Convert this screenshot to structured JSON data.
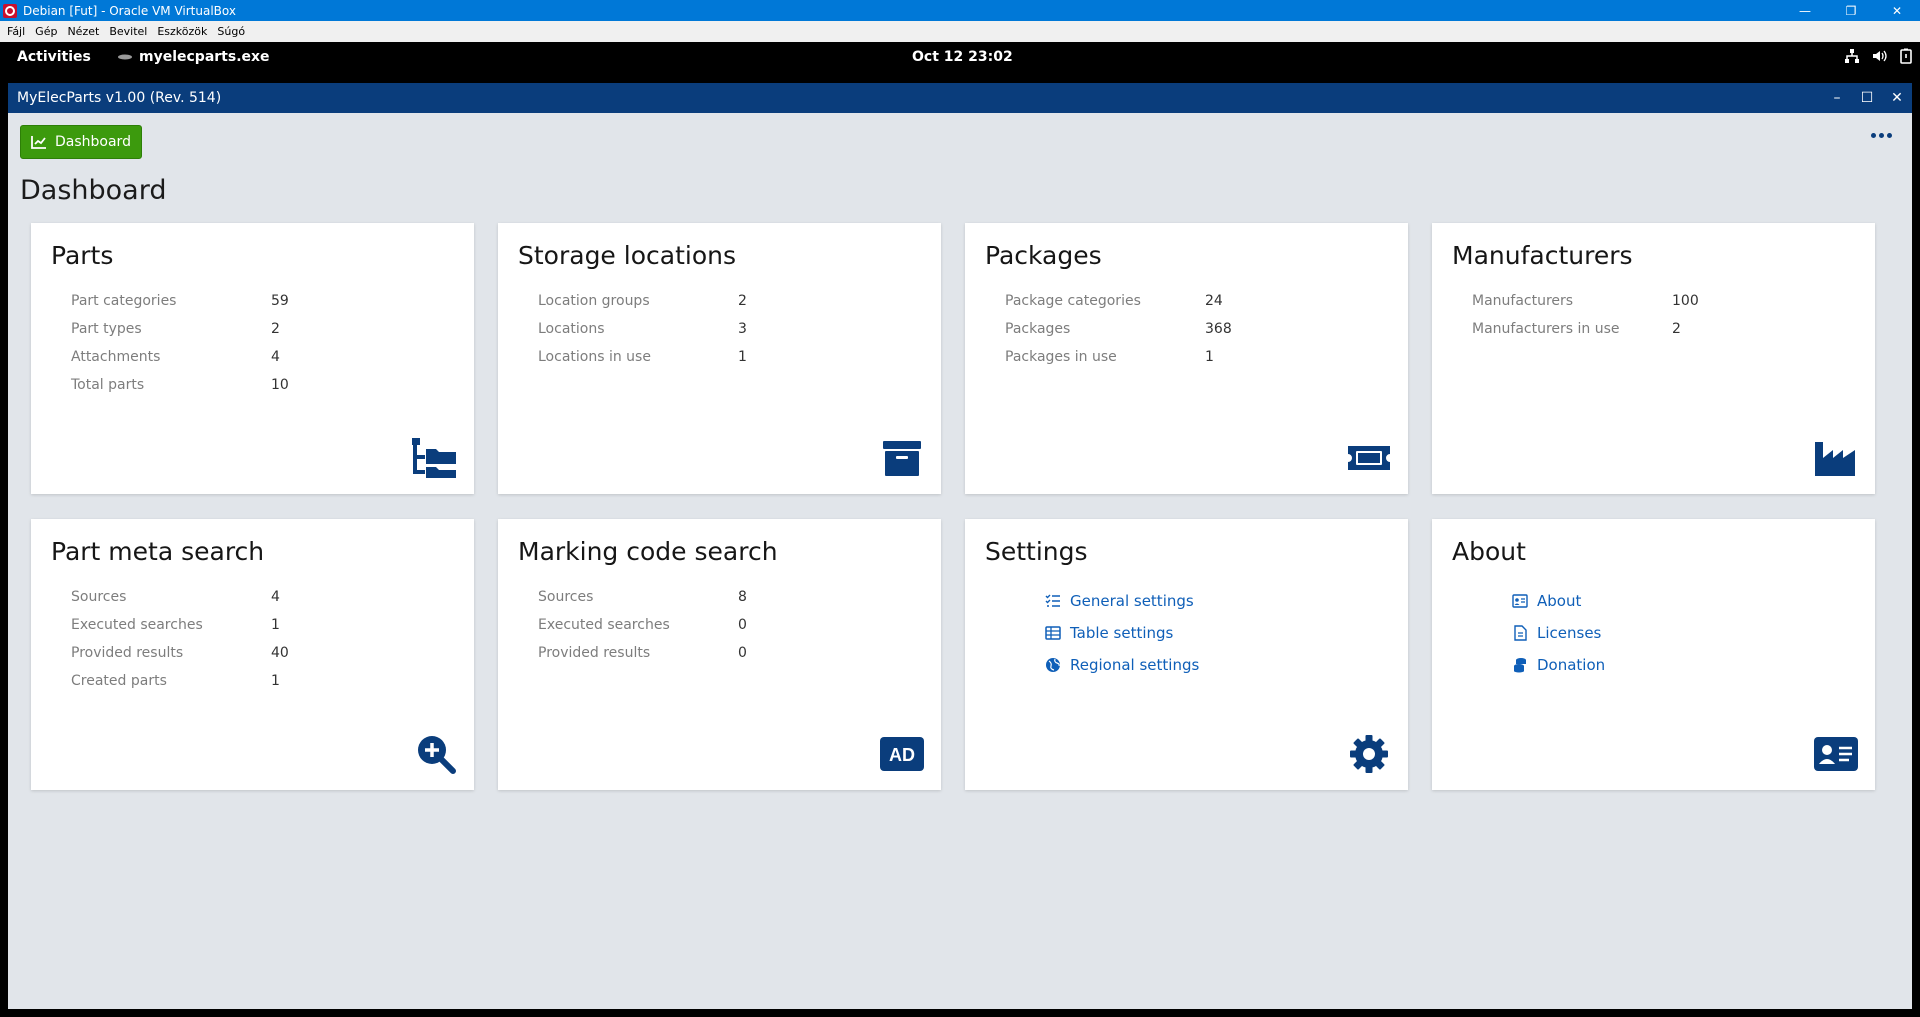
{
  "vbox": {
    "title": "Debian [Fut] - Oracle VM VirtualBox",
    "menu": [
      "Fájl",
      "Gép",
      "Nézet",
      "Bevitel",
      "Eszközök",
      "Súgó"
    ]
  },
  "gnome": {
    "activities": "Activities",
    "app_name": "myelecparts.exe",
    "clock": "Oct 12  23:02"
  },
  "app": {
    "title": "MyElecParts v1.00  (Rev. 514)",
    "dashboard_button": "Dashboard",
    "page_title": "Dashboard"
  },
  "cards": {
    "parts": {
      "title": "Parts",
      "rows": [
        {
          "label": "Part categories",
          "value": "59"
        },
        {
          "label": "Part types",
          "value": "2"
        },
        {
          "label": "Attachments",
          "value": "4"
        },
        {
          "label": "Total parts",
          "value": "10"
        }
      ]
    },
    "storage": {
      "title": "Storage locations",
      "rows": [
        {
          "label": "Location groups",
          "value": "2"
        },
        {
          "label": "Locations",
          "value": "3"
        },
        {
          "label": "Locations in use",
          "value": "1"
        }
      ]
    },
    "packages": {
      "title": "Packages",
      "rows": [
        {
          "label": "Package categories",
          "value": "24"
        },
        {
          "label": "Packages",
          "value": "368"
        },
        {
          "label": "Packages in use",
          "value": "1"
        }
      ]
    },
    "manufacturers": {
      "title": "Manufacturers",
      "rows": [
        {
          "label": "Manufacturers",
          "value": "100"
        },
        {
          "label": "Manufacturers in use",
          "value": "2"
        }
      ]
    },
    "meta_search": {
      "title": "Part meta search",
      "rows": [
        {
          "label": "Sources",
          "value": "4"
        },
        {
          "label": "Executed searches",
          "value": "1"
        },
        {
          "label": "Provided results",
          "value": "40"
        },
        {
          "label": "Created parts",
          "value": "1"
        }
      ]
    },
    "marking": {
      "title": "Marking code search",
      "rows": [
        {
          "label": "Sources",
          "value": "8"
        },
        {
          "label": "Executed searches",
          "value": "0"
        },
        {
          "label": "Provided results",
          "value": "0"
        }
      ],
      "icon_text": "AD"
    },
    "settings": {
      "title": "Settings",
      "links": [
        "General settings",
        "Table settings",
        "Regional settings"
      ]
    },
    "about": {
      "title": "About",
      "links": [
        "About",
        "Licenses",
        "Donation"
      ]
    }
  },
  "colors": {
    "accent": "#0a3d7c",
    "link": "#0f5fb8",
    "button": "#3c9a0d",
    "background": "#e1e5ea"
  }
}
